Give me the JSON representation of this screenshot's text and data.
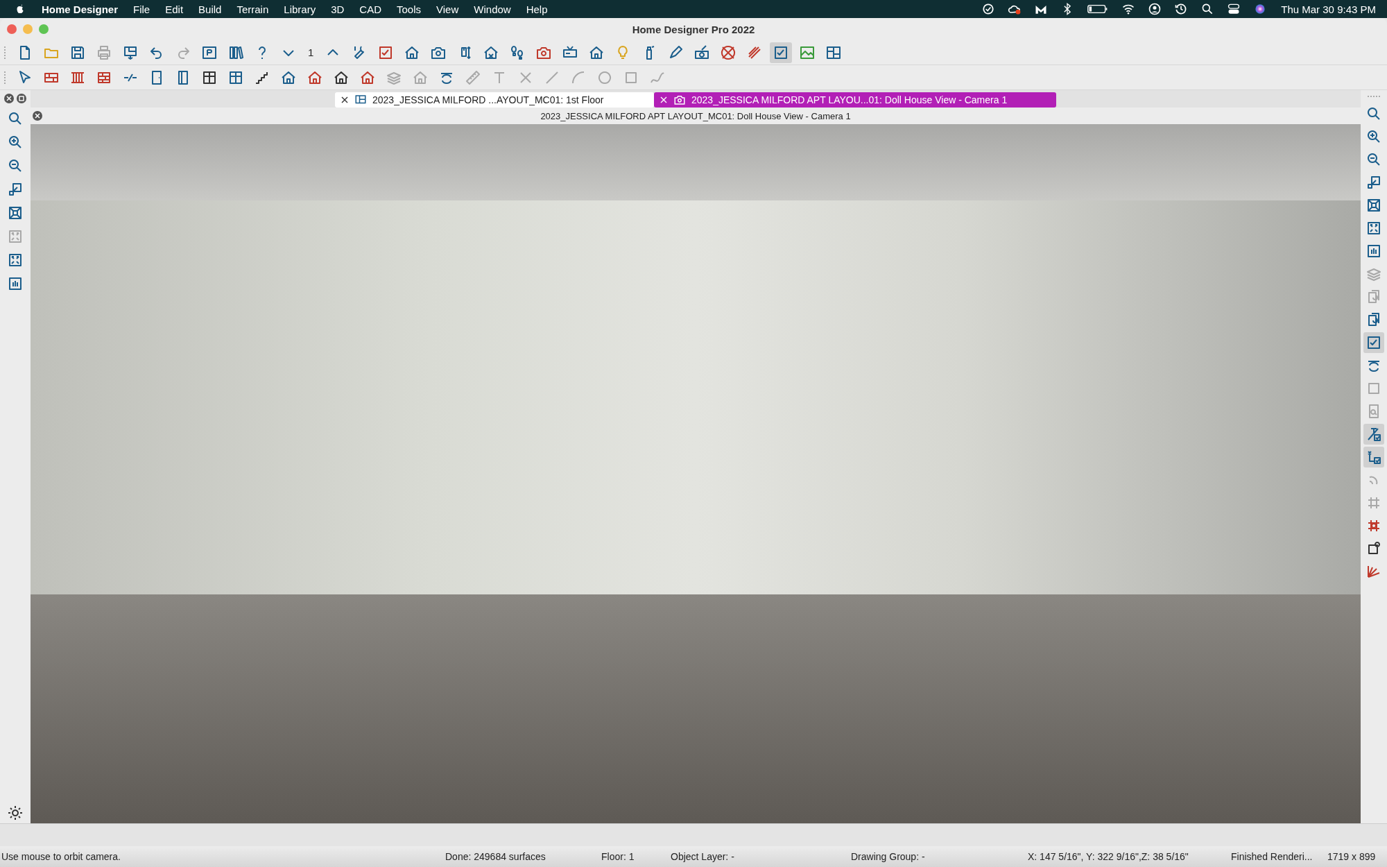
{
  "menu_bar": {
    "app_name": "Home Designer",
    "menus": [
      "File",
      "Edit",
      "Build",
      "Terrain",
      "Library",
      "3D",
      "CAD",
      "Tools",
      "View",
      "Window",
      "Help"
    ],
    "clock": "Thu Mar 30  9:43 PM"
  },
  "window": {
    "title": "Home Designer Pro 2022"
  },
  "toolbar": {
    "floor_number": "1"
  },
  "tabs": [
    {
      "label": "2023_JESSICA MILFORD ...AYOUT_MC01: 1st Floor",
      "selected": false,
      "kind": "plan"
    },
    {
      "label": "2023_JESSICA MILFORD APT LAYOU...01: Doll House View - Camera 1",
      "selected": true,
      "kind": "camera"
    }
  ],
  "view": {
    "title": "2023_JESSICA MILFORD APT LAYOUT_MC01: Doll House View - Camera 1"
  },
  "status_bar": {
    "items": [
      "Use mouse to orbit camera.",
      "Done:  249684 surfaces",
      "Floor: 1",
      "Object Layer: -",
      "Drawing Group: -",
      "X: 147 5/16\", Y: 322 9/16\",Z: 38 5/16\"",
      "Finished Renderi...",
      "1719 x 899"
    ]
  }
}
